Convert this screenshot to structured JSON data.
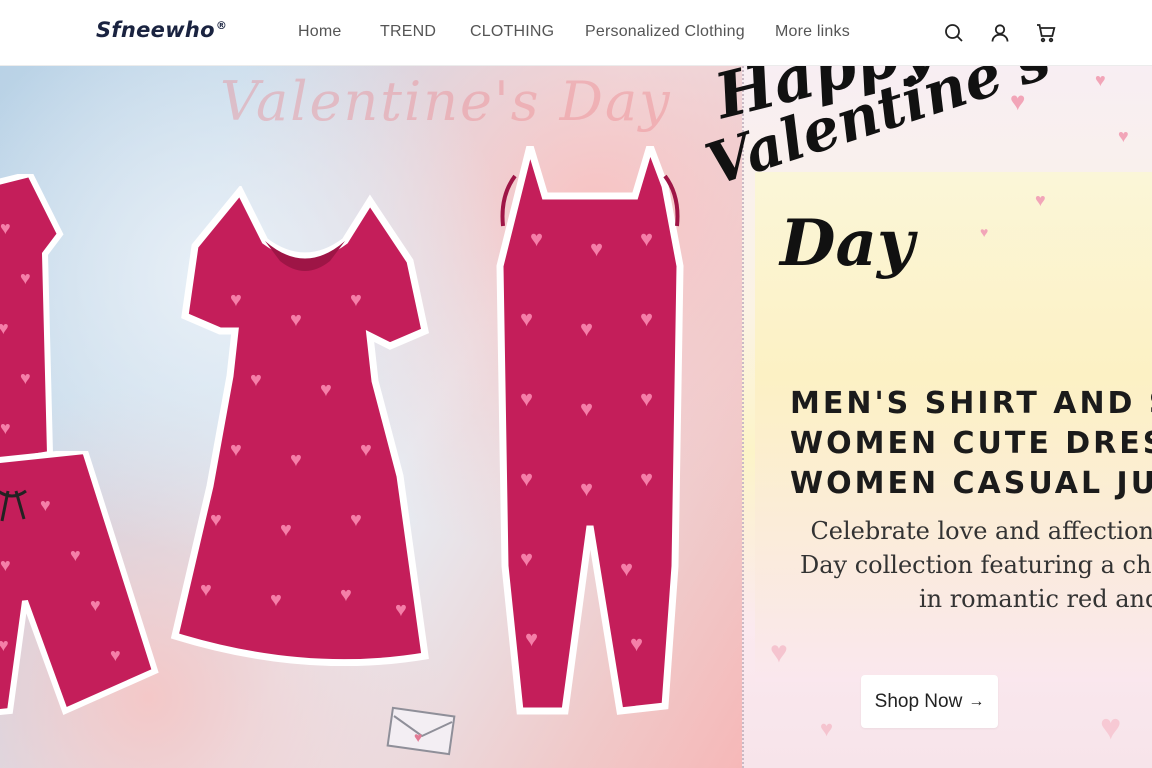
{
  "brand": {
    "name": "Sfneewho",
    "mark": "®"
  },
  "nav": {
    "items": [
      {
        "label": "Home"
      },
      {
        "label": "TREND"
      },
      {
        "label": "CLOTHING"
      },
      {
        "label": "Personalized Clothing"
      },
      {
        "label": "More links"
      }
    ]
  },
  "header_icons": [
    "search-icon",
    "account-icon",
    "cart-icon"
  ],
  "hero": {
    "background_script": "Valentine's Day",
    "script_title": [
      "Happy",
      "Valentine's",
      "Day"
    ],
    "headline": [
      "MEN'S SHIRT AND S",
      "WOMEN CUTE DRES",
      "WOMEN CASUAL JU"
    ],
    "subtext": [
      "Celebrate love and affection wit",
      "Day collection featuring a charm",
      "in romantic red and pi"
    ],
    "cta_label": "Shop Now",
    "cta_arrow": "→"
  },
  "colors": {
    "garment": "#c41e5a",
    "heart_pink": "#f47fa8",
    "heart_light": "#fbb6cc",
    "text_dark": "#1b1b1b"
  }
}
